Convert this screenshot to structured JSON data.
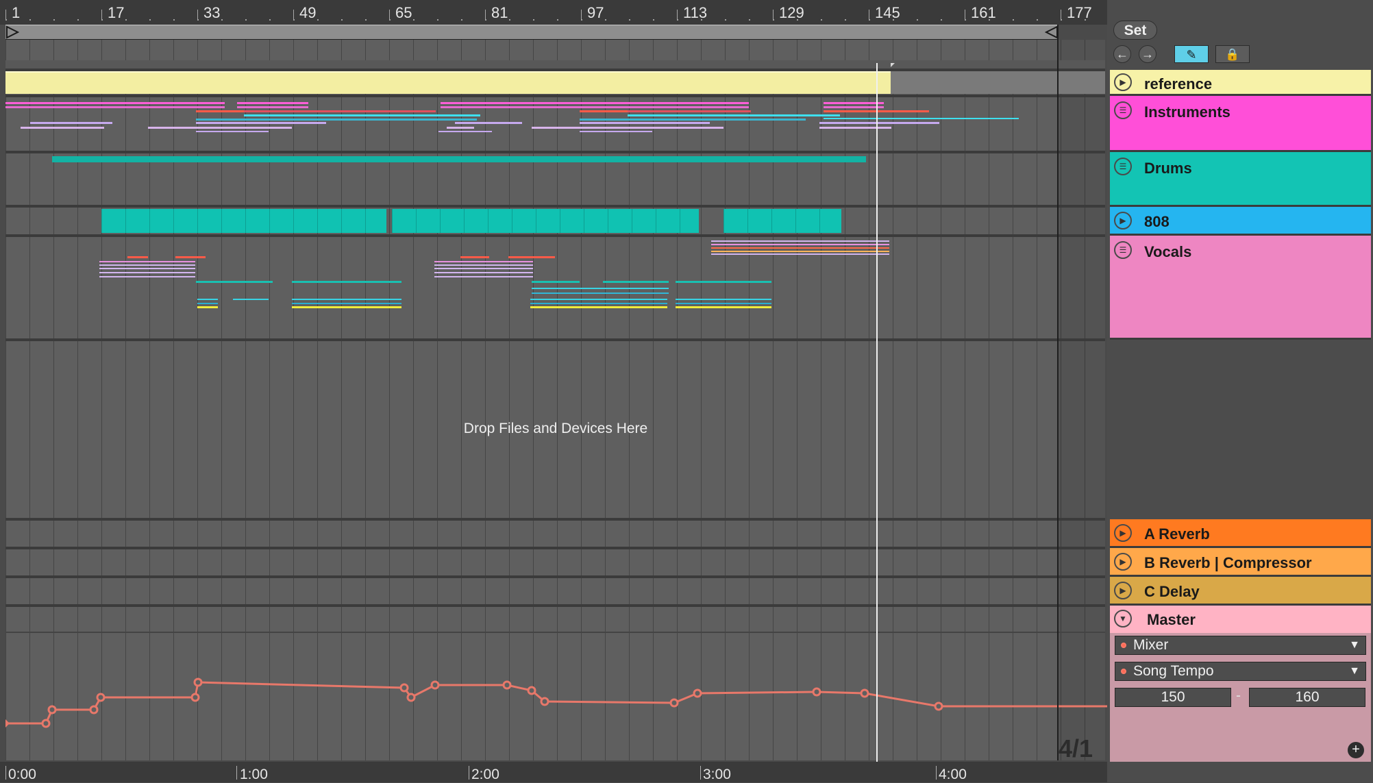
{
  "ruler": {
    "bars": [
      "1",
      "17",
      "33",
      "49",
      "65",
      "81",
      "97",
      "113",
      "129",
      "145",
      "161",
      "177"
    ]
  },
  "arrangement": {
    "drop_hint": "Drop Files and Devices Here",
    "grid_label": "4/1"
  },
  "time_ruler": [
    "0:00",
    "1:00",
    "2:00",
    "3:00",
    "4:00"
  ],
  "panel": {
    "set_label": "Set",
    "back_icon": "arrow-left-icon",
    "forward_icon": "arrow-right-icon",
    "draw_icon": "pencil-icon",
    "lock_icon": "lock-icon"
  },
  "tracks": [
    {
      "name": "reference",
      "icon": "play-icon",
      "color": "#f7f2a8"
    },
    {
      "name": "Instruments",
      "icon": "group-icon",
      "color": "#ff4fd8"
    },
    {
      "name": "Drums",
      "icon": "group-icon",
      "color": "#13c4b4"
    },
    {
      "name": "808",
      "icon": "play-icon",
      "color": "#25b5f0"
    },
    {
      "name": "Vocals",
      "icon": "group-icon",
      "color": "#ee86c2"
    },
    {
      "name": "A Reverb",
      "icon": "play-icon",
      "color": "#ff7a20"
    },
    {
      "name": "B Reverb | Compressor",
      "icon": "play-icon",
      "color": "#ffa84a"
    },
    {
      "name": "C Delay",
      "icon": "play-icon",
      "color": "#d9a848"
    },
    {
      "name": "Master",
      "icon": "collapse-icon",
      "color": "#ffb3c4"
    }
  ],
  "master": {
    "device_chooser": "Mixer",
    "parameter_chooser": "Song Tempo",
    "range_min": "150",
    "range_max": "160"
  }
}
